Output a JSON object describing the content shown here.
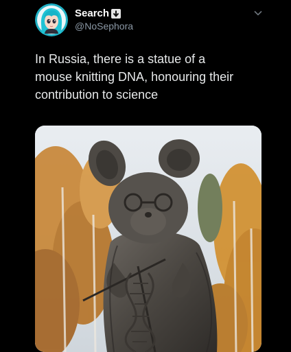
{
  "tweet": {
    "author": {
      "display_name": "Search",
      "handle": "@NoSephora",
      "avatar_icon": "cartoon-girl-avatar",
      "badge_icon": "download-arrow-icon"
    },
    "text_lines": [
      "In Russia, there is a statue of a",
      "mouse knitting DNA, honouring their",
      "contribution to science"
    ],
    "media": {
      "subject_icon": "mouse-statue-photo"
    },
    "more_icon": "chevron-down-icon"
  },
  "colors": {
    "background": "#000000",
    "text": "#e7e9ea",
    "handle": "#8b98a5",
    "badge": "#1d9bf0",
    "avatar_bg": "#28b6c9"
  }
}
